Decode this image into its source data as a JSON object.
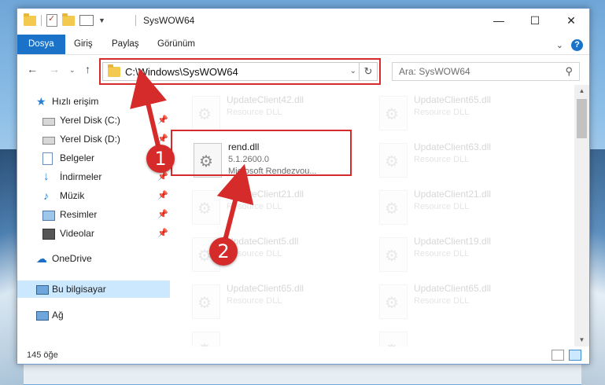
{
  "window": {
    "title": "SysWOW64",
    "minimize": "—",
    "maximize": "☐",
    "close": "✕"
  },
  "ribbon": {
    "tabs": [
      "Dosya",
      "Giriş",
      "Paylaş",
      "Görünüm"
    ],
    "help": "?"
  },
  "address": {
    "path": "C:\\Windows\\SysWOW64",
    "refresh_icon": "refresh-icon"
  },
  "search": {
    "placeholder": "Ara: SysWOW64"
  },
  "nav": {
    "items": [
      {
        "label": "Hızlı erişim",
        "icon": "star-icon",
        "pinned": false
      },
      {
        "label": "Yerel Disk (C:)",
        "icon": "drive-icon",
        "pinned": true
      },
      {
        "label": "Yerel Disk (D:)",
        "icon": "drive-icon",
        "pinned": true
      },
      {
        "label": "Belgeler",
        "icon": "documents-icon",
        "pinned": true
      },
      {
        "label": "İndirmeler",
        "icon": "download-icon",
        "pinned": true
      },
      {
        "label": "Müzik",
        "icon": "music-icon",
        "pinned": true
      },
      {
        "label": "Resimler",
        "icon": "pictures-icon",
        "pinned": true
      },
      {
        "label": "Videolar",
        "icon": "videos-icon",
        "pinned": true
      },
      {
        "label": "OneDrive",
        "icon": "cloud-icon",
        "pinned": false
      },
      {
        "label": "Bu bilgisayar",
        "icon": "computer-icon",
        "pinned": false,
        "selected": true
      },
      {
        "label": "Ağ",
        "icon": "network-icon",
        "pinned": false
      }
    ]
  },
  "files": {
    "highlighted": {
      "name": "rend.dll",
      "version": "5.1.2600.0",
      "description": "Microsoft Rendezvou..."
    },
    "background": [
      {
        "name": "UpdateClient42.dll",
        "type": "Resource DLL"
      },
      {
        "name": "UpdateClient65.dll",
        "type": "Resource DLL"
      },
      {
        "name": "UpdateClient63.dll",
        "type": "Resource DLL"
      },
      {
        "name": "UpdateClient21.dll",
        "type": "Resource DLL"
      },
      {
        "name": "UpdateClient21.dll",
        "type": "Resource DLL"
      },
      {
        "name": "UpdateClient5.dll",
        "type": "Resource DLL"
      },
      {
        "name": "UpdateClient19.dll",
        "type": "Resource DLL"
      },
      {
        "name": "UpdateClient65.dll",
        "type": "Resource DLL"
      },
      {
        "name": "UpdateClient65.dll",
        "type": "Resource DLL"
      }
    ]
  },
  "status": {
    "count": "145 öğe"
  },
  "annotations": {
    "step1": "1",
    "step2": "2",
    "color": "#d62b2b"
  }
}
